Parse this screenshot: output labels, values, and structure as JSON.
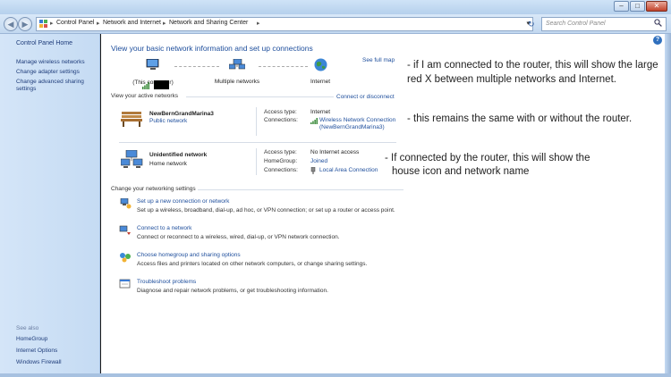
{
  "titlebar": {
    "minimize": "–",
    "maximize": "□",
    "close": "✕"
  },
  "nav": {
    "back": "◀",
    "forward": "▶",
    "breadcrumb": [
      "Control Panel",
      "Network and Internet",
      "Network and Sharing Center"
    ],
    "separator": "▸",
    "dropdown": "▾",
    "refresh": "↻",
    "search_placeholder": "Search Control Panel"
  },
  "sidebar": {
    "home": "Control Panel Home",
    "links": [
      "Manage wireless networks",
      "Change adapter settings",
      "Change advanced sharing settings"
    ],
    "see_also_label": "See also",
    "see_also": [
      "HomeGroup",
      "Internet Options",
      "Windows Firewall"
    ]
  },
  "main": {
    "help": "?",
    "heading": "View your basic network information and set up connections",
    "see_full_map": "See full map",
    "map": {
      "computer_label": "(This computer)",
      "multiple_label": "Multiple networks",
      "internet_label": "Internet"
    },
    "active_label": "View your active networks",
    "connect_label": "Connect or disconnect",
    "networks": [
      {
        "name": "NewBernGrandMarina3",
        "type": "Public network",
        "rows": [
          {
            "k": "Access type:",
            "v": "Internet"
          },
          {
            "k": "Connections:",
            "v": "Wireless Network Connection (NewBernGrandMarina3)"
          }
        ]
      },
      {
        "name": "Unidentified network",
        "type": "Home network",
        "rows": [
          {
            "k": "Access type:",
            "v": "No Internet access"
          },
          {
            "k": "HomeGroup:",
            "v": "Joined"
          },
          {
            "k": "Connections:",
            "v": "Local Area Connection"
          }
        ]
      }
    ],
    "change_label": "Change your networking settings",
    "tasks": [
      {
        "title": "Set up a new connection or network",
        "desc": "Set up a wireless, broadband, dial-up, ad hoc, or VPN connection; or set up a router or access point."
      },
      {
        "title": "Connect to a network",
        "desc": "Connect or reconnect to a wireless, wired, dial-up, or VPN network connection."
      },
      {
        "title": "Choose homegroup and sharing options",
        "desc": "Access files and printers located on other network computers, or change sharing settings."
      },
      {
        "title": "Troubleshoot problems",
        "desc": "Diagnose and repair network problems, or get troubleshooting information."
      }
    ]
  },
  "annotations": {
    "a1": "- if I am connected to the router, this will show the large red X  between multiple networks and Internet.",
    "a2": "- this remains the same with or without the router.",
    "a3_line1": "- If connected by the router, this will show the",
    "a3_line2": "house icon and network name"
  }
}
